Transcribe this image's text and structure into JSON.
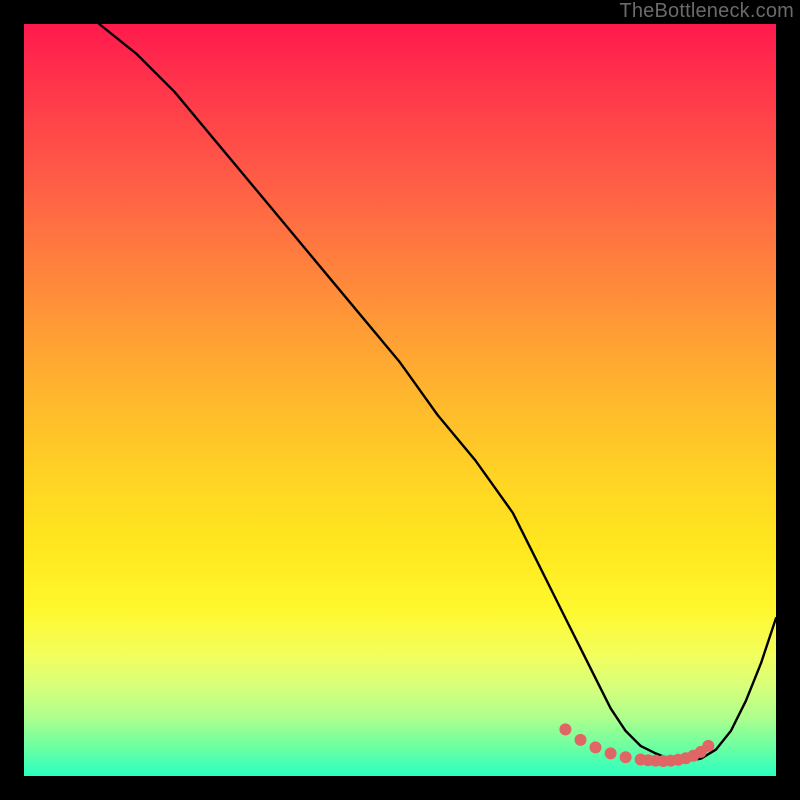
{
  "watermark": "TheBottleneck.com",
  "chart_data": {
    "type": "line",
    "title": "",
    "xlabel": "",
    "ylabel": "",
    "xlim": [
      0,
      100
    ],
    "ylim": [
      0,
      100
    ],
    "grid": false,
    "legend": false,
    "series": [
      {
        "name": "curve",
        "color": "#000000",
        "x": [
          10,
          15,
          20,
          25,
          30,
          35,
          40,
          45,
          50,
          55,
          60,
          65,
          68,
          70,
          72,
          74,
          76,
          78,
          80,
          82,
          84,
          86,
          88,
          90,
          92,
          94,
          96,
          98,
          100
        ],
        "y": [
          100,
          96,
          91,
          85,
          79,
          73,
          67,
          61,
          55,
          48,
          42,
          35,
          29,
          25,
          21,
          17,
          13,
          9,
          6,
          4,
          3,
          2.2,
          2,
          2.3,
          3.5,
          6,
          10,
          15,
          21
        ]
      },
      {
        "name": "highlight-dots",
        "color": "#e06666",
        "x": [
          72,
          74,
          76,
          78,
          80,
          82,
          83,
          84,
          85,
          86,
          87,
          88,
          89,
          90,
          91
        ],
        "y": [
          6.2,
          4.8,
          3.8,
          3.0,
          2.5,
          2.2,
          2.1,
          2.05,
          2.0,
          2.05,
          2.15,
          2.35,
          2.7,
          3.2,
          4.0
        ]
      }
    ]
  }
}
